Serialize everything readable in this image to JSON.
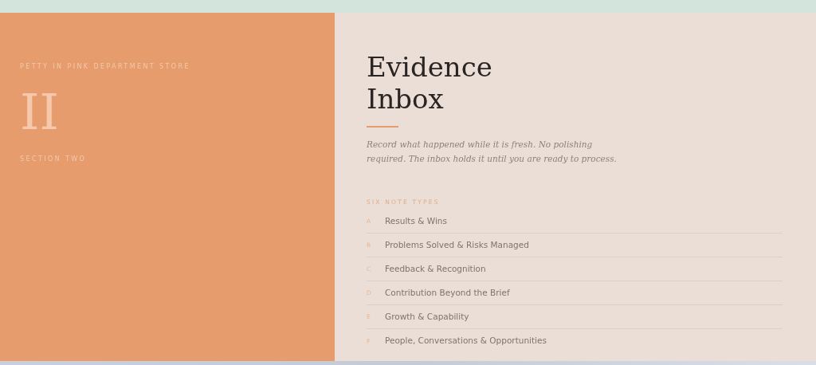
{
  "left_panel": {
    "store": "PETTY IN PINK DEPARTMENT STORE",
    "numeral": "II",
    "section": "SECTION TWO"
  },
  "main": {
    "title_lines": [
      "Evidence",
      "Inbox"
    ],
    "intro": "Record what happened while it is fresh. No polishing required. The inbox holds it until you are ready to process.",
    "list_heading": "SIX NOTE TYPES",
    "note_types": [
      {
        "letter": "A",
        "label": "Results & Wins"
      },
      {
        "letter": "B",
        "label": "Problems Solved & Risks Managed"
      },
      {
        "letter": "C",
        "label": "Feedback & Recognition"
      },
      {
        "letter": "D",
        "label": "Contribution Beyond the Brief"
      },
      {
        "letter": "E",
        "label": "Growth & Capability"
      },
      {
        "letter": "F",
        "label": "People, Conversations & Opportunities"
      }
    ]
  }
}
